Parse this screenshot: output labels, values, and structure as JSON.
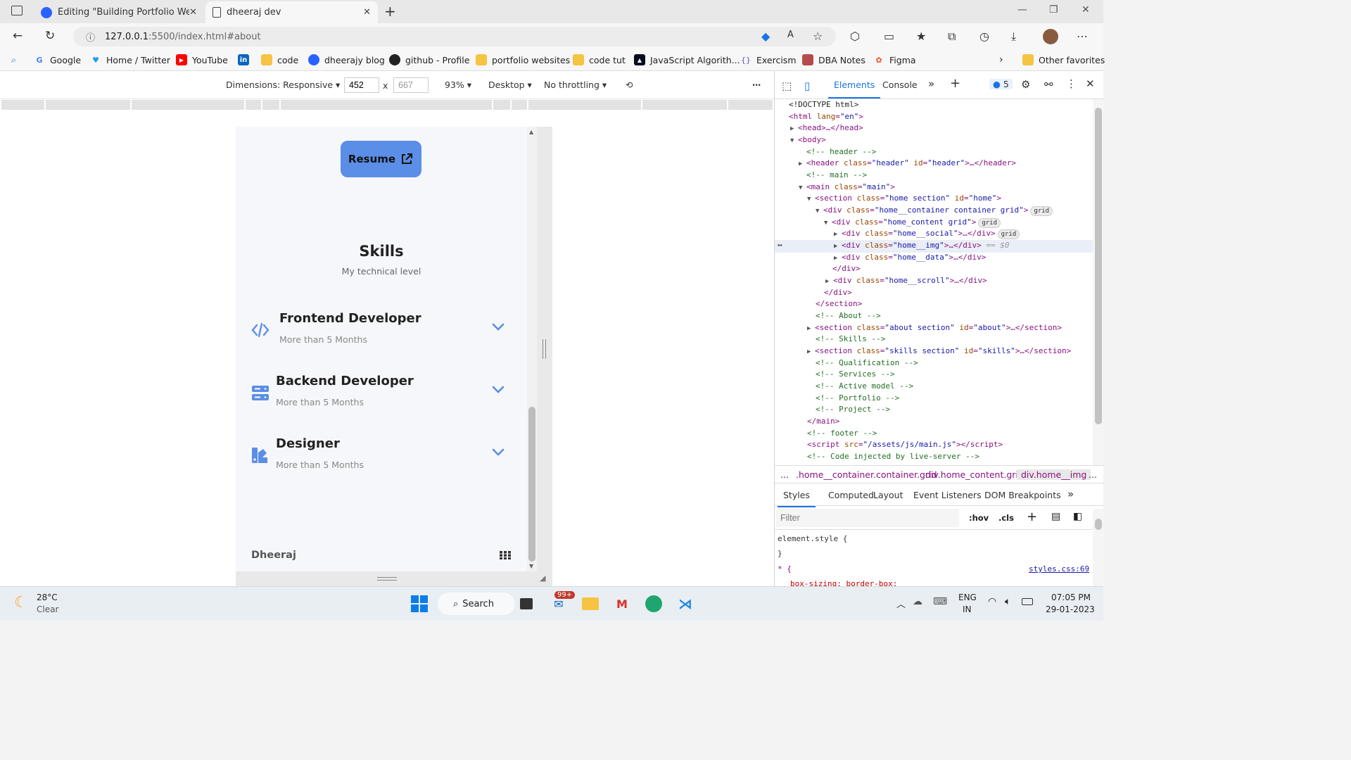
{
  "browser": {
    "tabs": [
      {
        "title": "Editing \"Building Portfolio Websi",
        "close": "✕"
      },
      {
        "title": "dheeraj dev",
        "close": "✕"
      }
    ],
    "new_tab": "+",
    "url_host": "127.0.0.1",
    "url_path": ":5500/index.html#about",
    "favorites": [
      {
        "label": "Google",
        "icon": "google-icon"
      },
      {
        "label": "Home / Twitter",
        "icon": "twitter-icon"
      },
      {
        "label": "YouTube",
        "icon": "youtube-icon"
      },
      {
        "label": "",
        "icon": "linkedin-icon"
      },
      {
        "label": "code",
        "icon": "folder-icon"
      },
      {
        "label": "dheerajy blog",
        "icon": "hashnode-icon"
      },
      {
        "label": "github - Profile",
        "icon": "github-icon"
      },
      {
        "label": "portfolio websites",
        "icon": "folder-icon"
      },
      {
        "label": "code tut",
        "icon": "folder-icon"
      },
      {
        "label": "JavaScript Algorith...",
        "icon": "freecodecamp-icon"
      },
      {
        "label": "Exercism",
        "icon": "exercism-icon"
      },
      {
        "label": "DBA Notes",
        "icon": "dba-icon"
      },
      {
        "label": "Figma",
        "icon": "figma-icon"
      }
    ],
    "other_favorites": "Other favorites"
  },
  "device_toolbar": {
    "dimensions": "Dimensions: Responsive",
    "width": "452",
    "height": "667",
    "times": "x",
    "zoom": "93%",
    "device_type": "Desktop",
    "throttling": "No throttling"
  },
  "page": {
    "resume_label": "Resume",
    "skills_title": "Skills",
    "skills_subtitle": "My technical level",
    "skills": [
      {
        "name": "Frontend Developer",
        "experience": "More than 5 Months",
        "icon": "code-icon"
      },
      {
        "name": "Backend Developer",
        "experience": "More than 5 Months",
        "icon": "server-icon"
      },
      {
        "name": "Designer",
        "experience": "More than 5 Months",
        "icon": "swatchbook-icon"
      }
    ],
    "footer_name": "Dheeraj"
  },
  "devtools": {
    "tabs": [
      "Elements",
      "Console"
    ],
    "issues_count": "5",
    "breadcrumbs": [
      "...",
      ".home__container.container.grid",
      "div.home_content.grid",
      "div.home__img",
      "..."
    ],
    "style_tabs": [
      "Styles",
      "Computed",
      "Layout",
      "Event Listeners",
      "DOM Breakpoints"
    ],
    "filter_placeholder": "Filter",
    "hov": ":hov",
    "cls": ".cls",
    "css_lines": [
      "element.style {",
      "}",
      "* {",
      "box-sizing: border-box;"
    ],
    "css_source": "styles.css:69"
  },
  "taskbar": {
    "weather_temp": "28°C",
    "weather_desc": "Clear",
    "search_label": "Search",
    "mail_badge": "99+",
    "lang1": "ENG",
    "lang2": "IN",
    "time": "07:05 PM",
    "date": "29-01-2023"
  }
}
